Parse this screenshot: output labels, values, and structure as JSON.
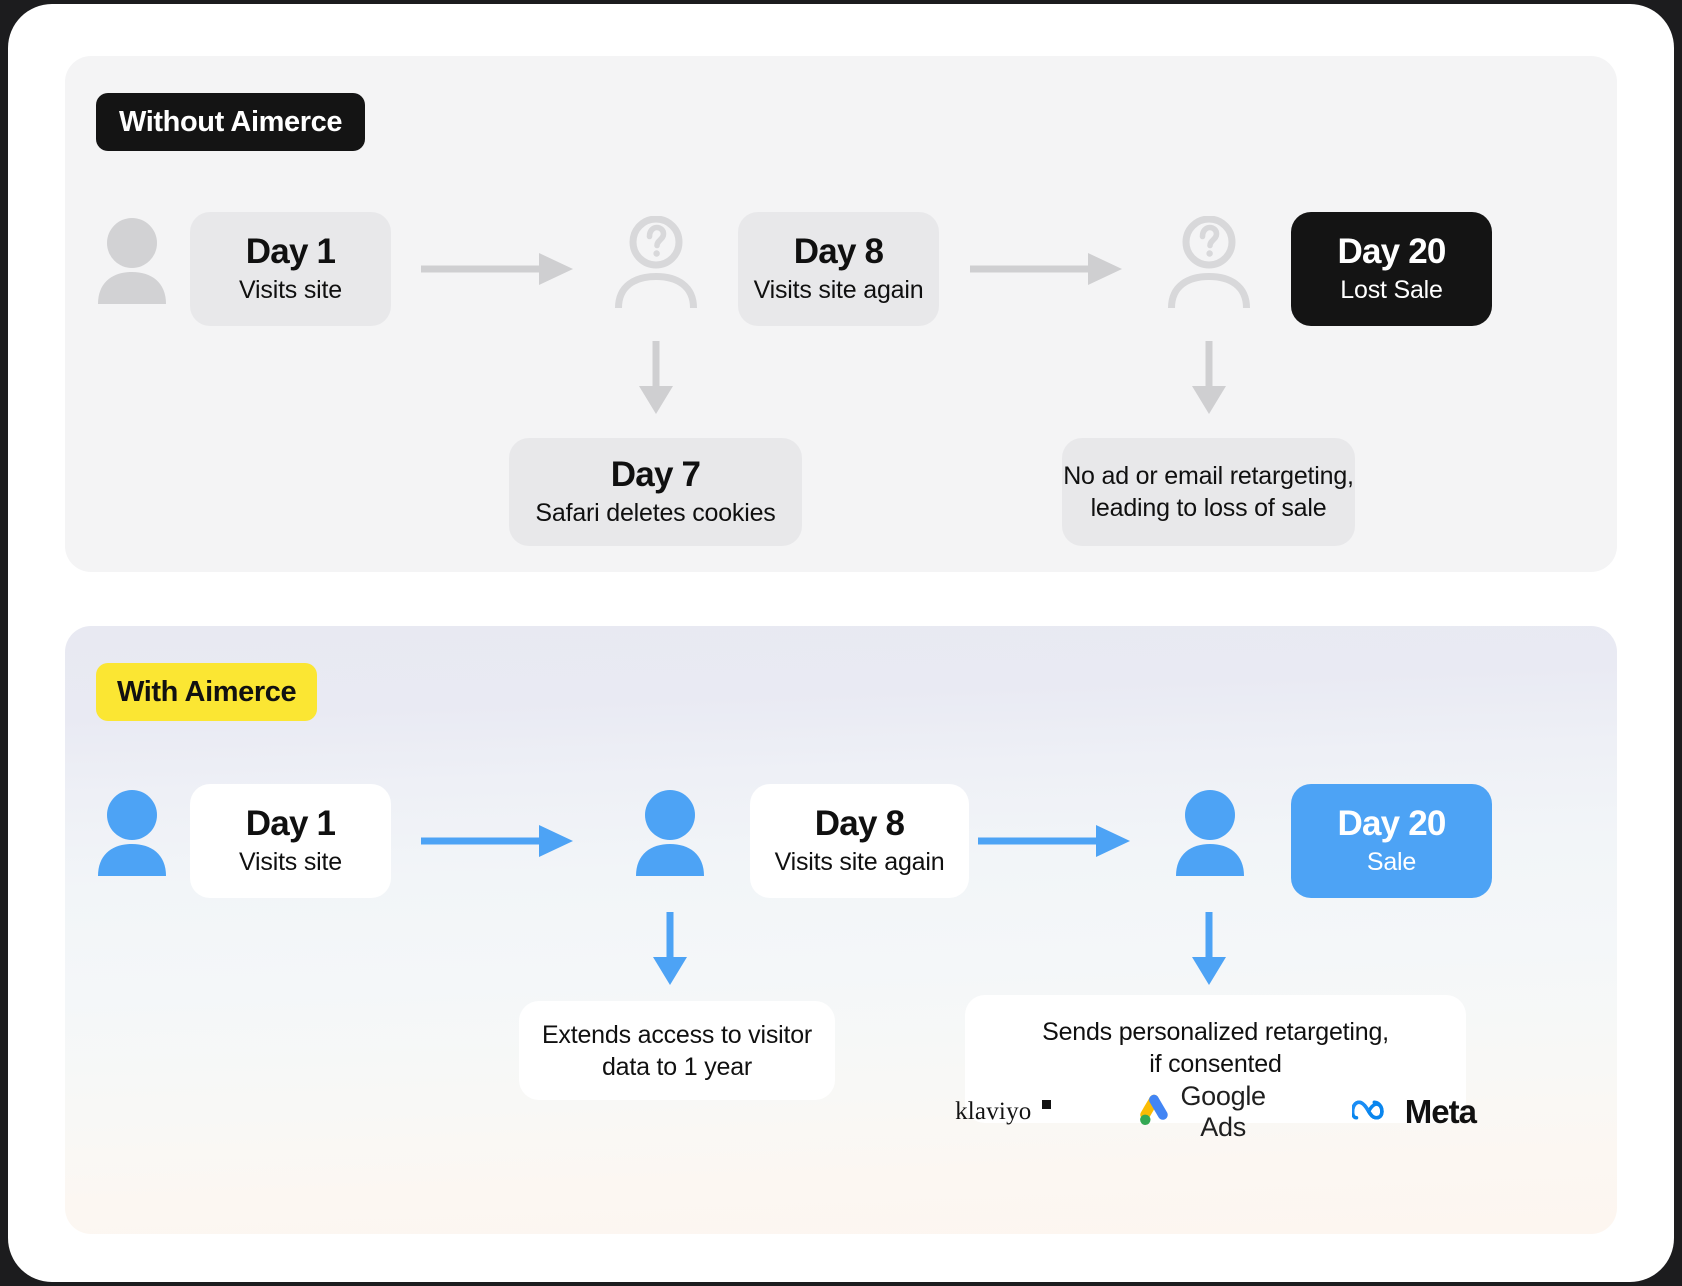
{
  "colors": {
    "page_background": "#1c1c1e",
    "card_background": "#ffffff",
    "panel_without_bg": "#f4f4f5",
    "panel_with_bg_top": "#e8e9f2",
    "panel_with_bg_bottom": "#fdf6f0",
    "badge_without_bg": "#141414",
    "badge_with_bg": "#fbe633",
    "accent_blue": "#4da3f5",
    "grey_card": "#e8e8ea",
    "grey_icon": "#d2d2d4",
    "grey_arrow": "#cfcfd1",
    "dark": "#141414"
  },
  "without": {
    "badge_label": "Without Aimerce",
    "visitor_icon": "person-filled-grey-icon",
    "nodes": [
      {
        "title": "Day 1",
        "sub": "Visits site"
      },
      {
        "title": "Day 8",
        "sub": "Visits site again"
      },
      {
        "title": "Day 20",
        "sub": "Lost Sale"
      }
    ],
    "unknown_icon_1": "person-unknown-question-icon",
    "unknown_icon_2": "person-unknown-question-icon",
    "arrow_1": "arrow-right-grey-icon",
    "arrow_2": "arrow-right-grey-icon",
    "arrow_down_1": "arrow-down-grey-icon",
    "arrow_down_2": "arrow-down-grey-icon",
    "drop_1": {
      "title": "Day 7",
      "sub": "Safari deletes cookies"
    },
    "drop_2": {
      "line1": "No ad or email retargeting,",
      "line2": "leading to loss of sale"
    }
  },
  "with": {
    "badge_label": "With Aimerce",
    "visitor_icon": "person-filled-blue-icon",
    "nodes": [
      {
        "title": "Day 1",
        "sub": "Visits site"
      },
      {
        "title": "Day 8",
        "sub": "Visits site again"
      },
      {
        "title": "Day 20",
        "sub": "Sale"
      }
    ],
    "known_icon_1": "person-filled-blue-icon",
    "known_icon_2": "person-filled-blue-icon",
    "arrow_1": "arrow-right-blue-icon",
    "arrow_2": "arrow-right-blue-icon",
    "arrow_down_1": "arrow-down-blue-icon",
    "arrow_down_2": "arrow-down-blue-icon",
    "drop_1": {
      "line1": "Extends access to visitor",
      "line2": "data to 1 year"
    },
    "drop_2": {
      "line1": "Sends personalized retargeting,",
      "line2": "if consented"
    },
    "logos": [
      {
        "name": "klaviyo",
        "label": "klaviyo",
        "icon": "klaviyo-logo"
      },
      {
        "name": "google-ads",
        "label": "Google Ads",
        "icon": "google-ads-logo"
      },
      {
        "name": "meta",
        "label": "Meta",
        "icon": "meta-logo"
      }
    ]
  }
}
